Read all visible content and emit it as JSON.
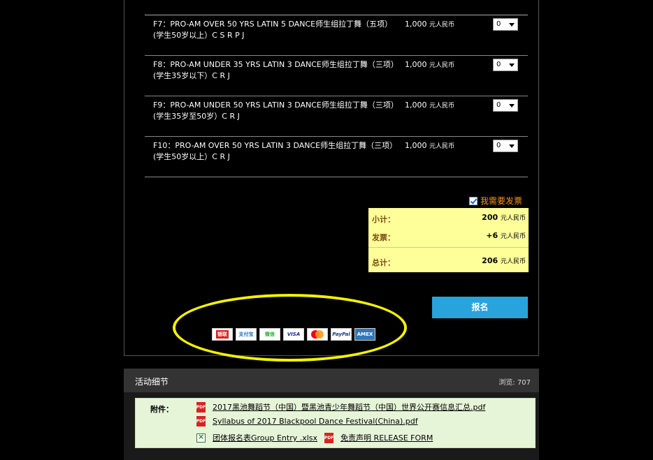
{
  "items": [
    {
      "name": "F7：PRO-AM OVER 50 YRS LATIN 5 DANCE师生组拉丁舞（五项）(学生50岁以上）C S R P J",
      "price": "1,000",
      "unit": "元人民币",
      "qty": "0"
    },
    {
      "name": "F8：PRO-AM UNDER 35 YRS LATIN 3 DANCE师生组拉丁舞（三项）(学生35岁以下）C R J",
      "price": "1,000",
      "unit": "元人民币",
      "qty": "0"
    },
    {
      "name": "F9：PRO-AM UNDER 50 YRS LATIN 3 DANCE师生组拉丁舞（三项）(学生35岁至50岁）C R J",
      "price": "1,000",
      "unit": "元人民币",
      "qty": "0"
    },
    {
      "name": "F10：PRO-AM OVER 50 YRS LATIN 3 DANCE师生组拉丁舞（三项）(学生50岁以上）C R J",
      "price": "1,000",
      "unit": "元人民币",
      "qty": "0"
    }
  ],
  "invoice": {
    "label": "我需要发票",
    "checked": true
  },
  "summary": {
    "subtotal_label": "小计：",
    "subtotal_value": "200",
    "subtotal_unit": "元人民币",
    "invoice_label": "发票：",
    "invoice_value": "+6",
    "invoice_unit": "元人民币",
    "total_label": "总计：",
    "total_value": "206",
    "total_unit": "元人民币"
  },
  "register_label": "报名",
  "payment_methods": [
    "银联",
    "支付宝",
    "微信",
    "VISA",
    "MasterCard",
    "PayPal",
    "AMEX"
  ],
  "details": {
    "title": "活动细节",
    "views": "浏览: 707",
    "attachments_label": "附件：",
    "files": [
      "2017黑池舞蹈节（中国）暨黑池青少年舞蹈节（中国）世界公开赛信息汇总.pdf",
      "Syllabus of 2017 Blackpool Dance Festival(China).pdf",
      "团体报名表Group Entry .xlsx",
      "免责声明 RELEASE FORM"
    ]
  },
  "colors": {
    "accent_button": "#29a3dc",
    "summary_bg": "#ffff99",
    "invoice_text": "#f7941d",
    "highlight": "#f2f200"
  }
}
